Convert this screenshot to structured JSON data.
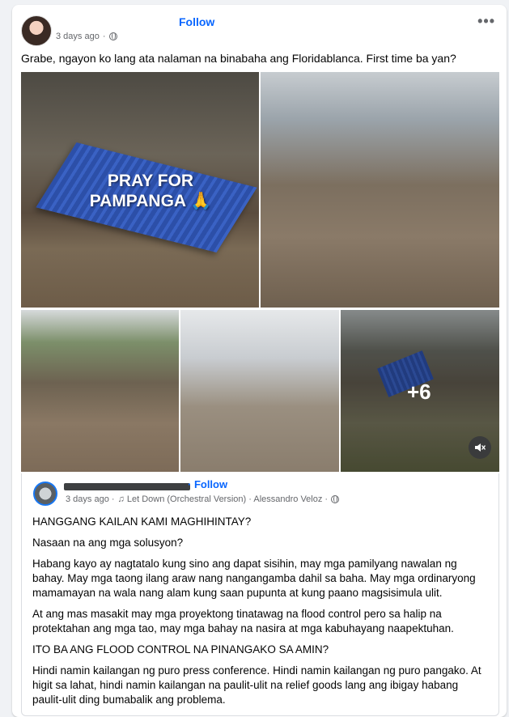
{
  "post": {
    "follow_label": "Follow",
    "time": "3 days ago",
    "more_label": "•••",
    "caption": "Grabe, ngayon ko lang ata nalaman na binabaha ang Floridablanca. First time ba yan?"
  },
  "media": {
    "overlay_text": "PRAY FOR PAMPANGA 🙏",
    "more_count": "+6",
    "mute_icon": "speaker-muted-icon"
  },
  "shared": {
    "follow_label": "· Follow",
    "time": "3 days ago ·",
    "music": "♫ Let Down (Orchestral Version) · Alessandro Veloz ·",
    "paragraphs": [
      "HANGGANG KAILAN KAMI MAGHIHINTAY?",
      "Nasaan na ang mga solusyon?",
      "Habang kayo ay nagtatalo kung sino ang dapat sisihin, may mga pamilyang nawalan ng bahay. May mga taong ilang araw nang nangangamba dahil sa baha. May mga ordinaryong mamamayan na wala nang alam kung saan pupunta at kung paano magsisimula ulit.",
      "At ang mas masakit may mga proyektong tinatawag na flood control pero sa halip na protektahan ang mga tao, may mga bahay na nasira at mga kabuhayang naapektuhan.",
      "ITO BA ANG FLOOD CONTROL NA PINANGAKO SA AMIN?",
      "Hindi namin kailangan ng puro press conference. Hindi namin kailangan ng puro pangako. At higit sa lahat, hindi namin kailangan na paulit-ulit na relief goods lang ang ibigay habang paulit-ulit ding bumabalik ang problema."
    ]
  },
  "colors": {
    "link": "#0866ff",
    "text": "#050505",
    "muted": "#65676b",
    "background": "#f0f2f5"
  }
}
